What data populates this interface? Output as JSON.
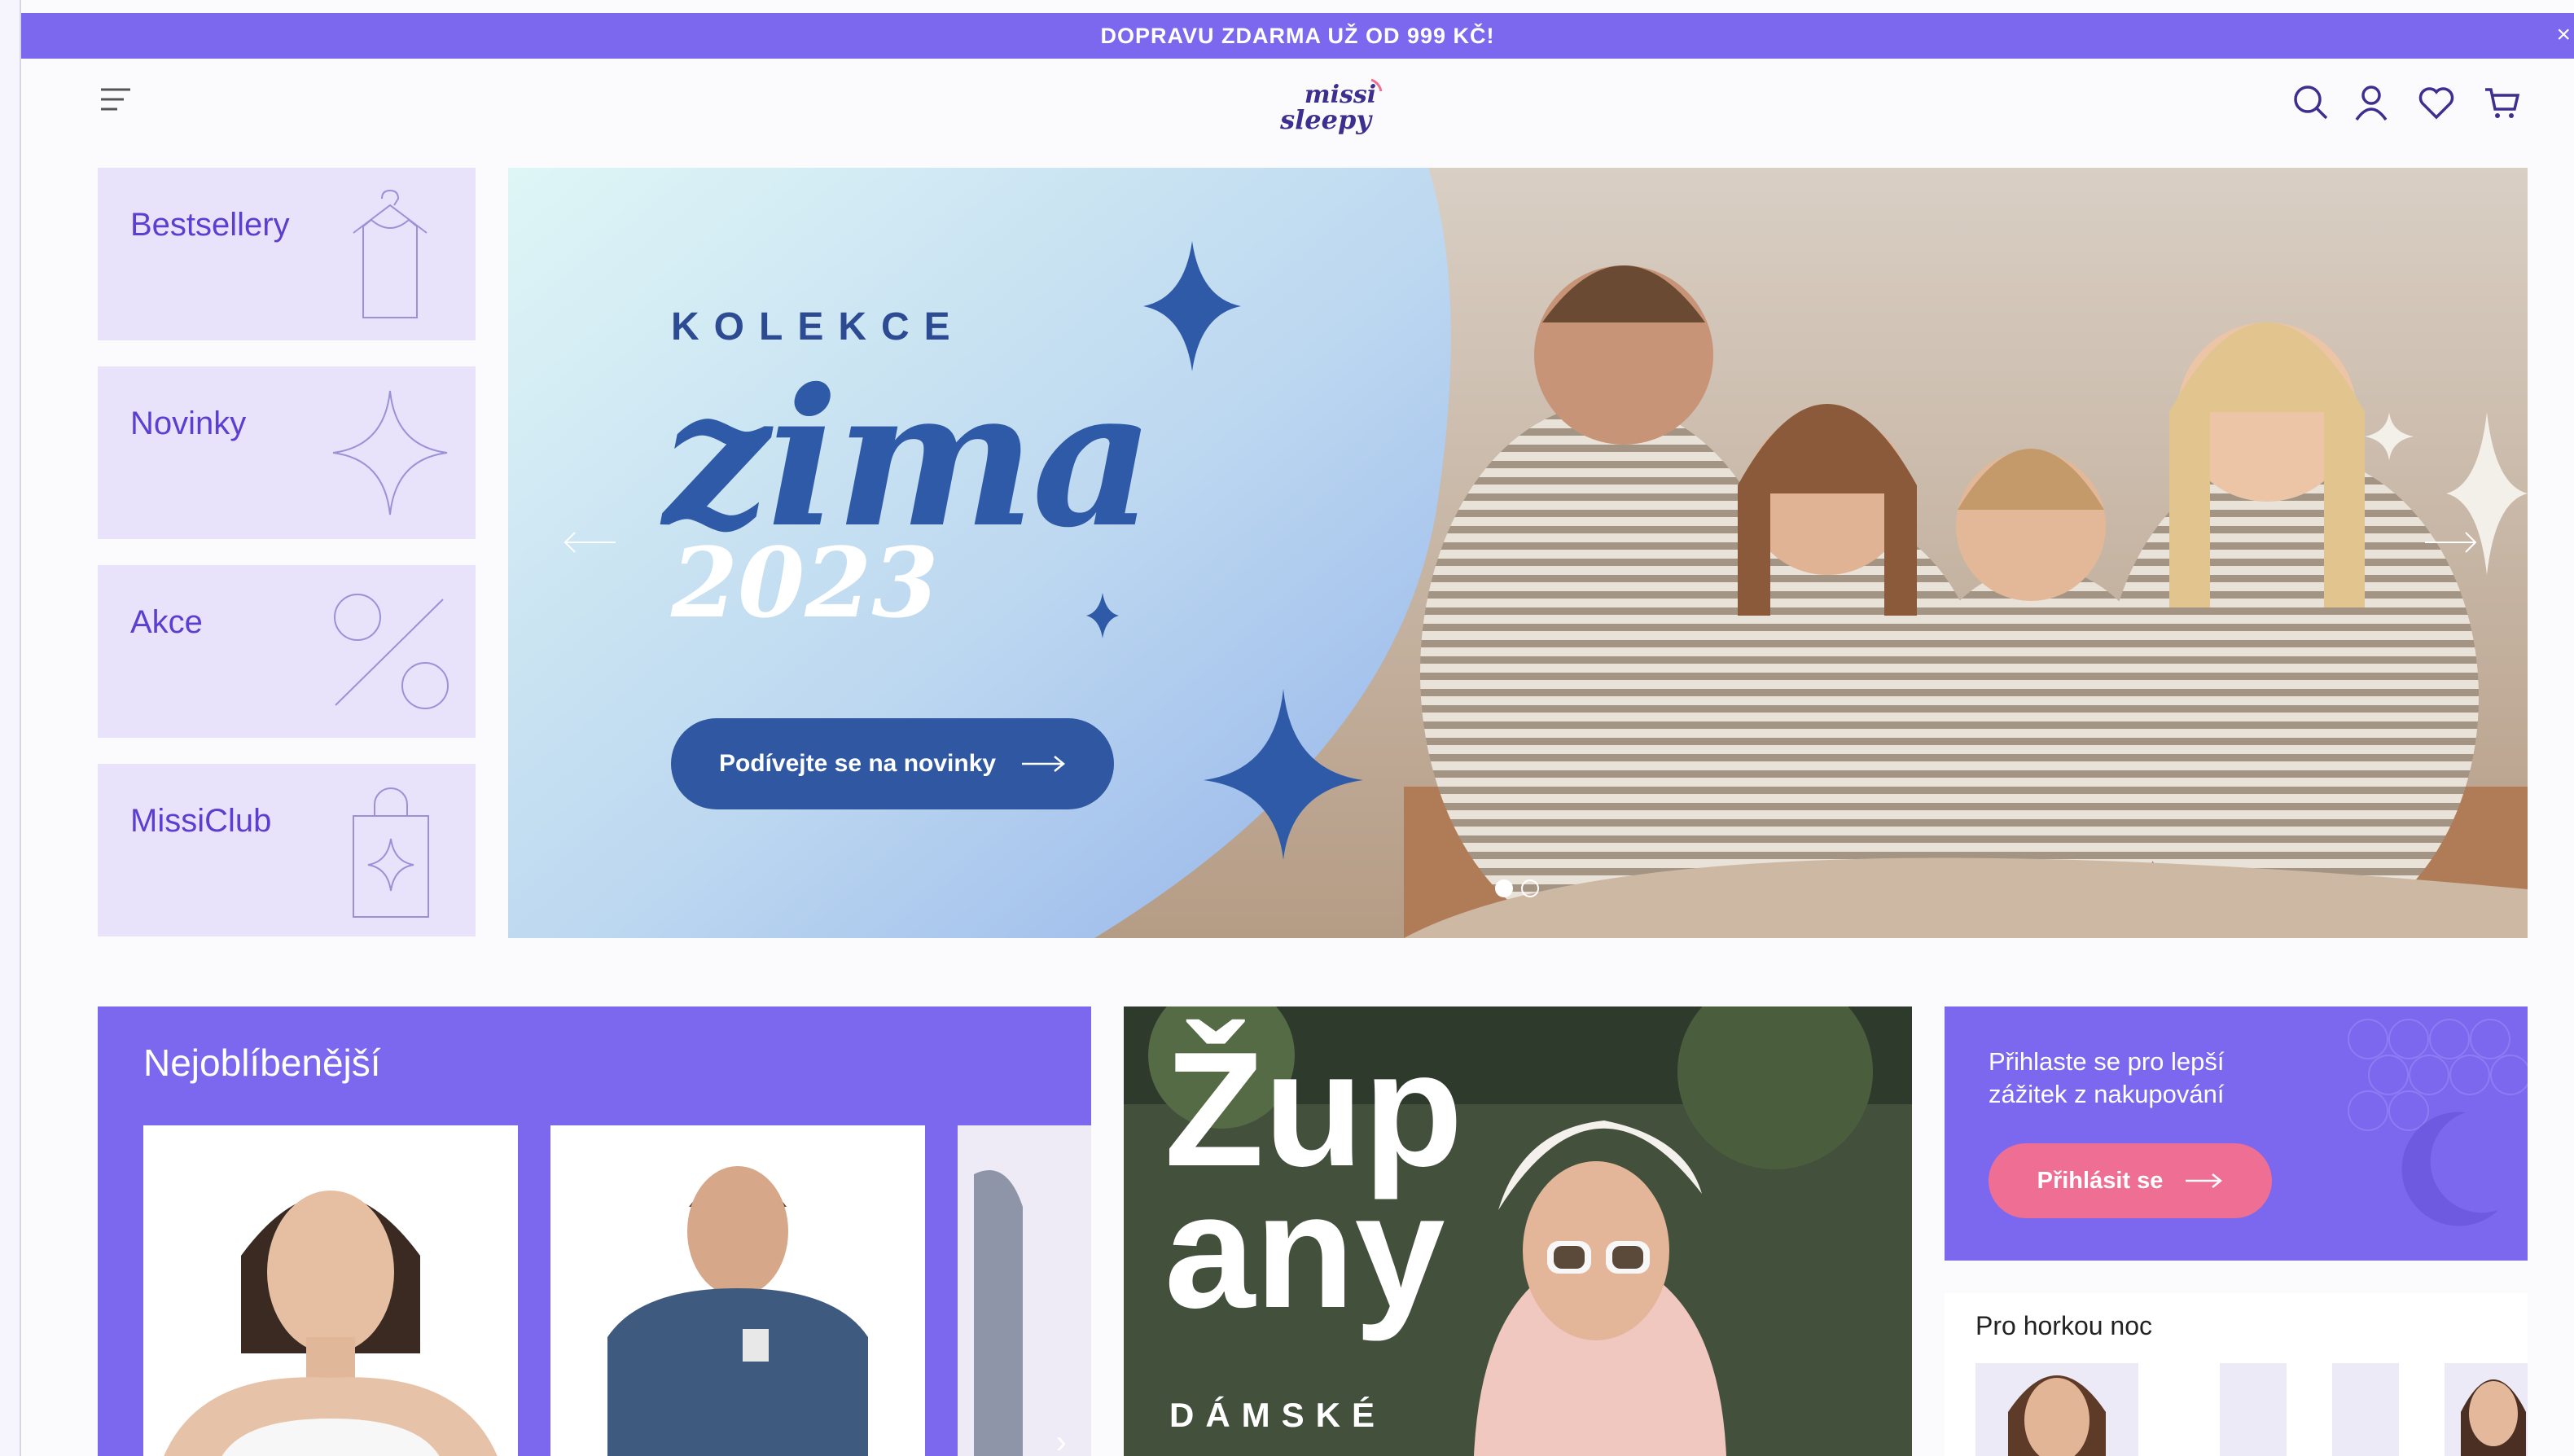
{
  "promo_bar": {
    "text": "DOPRAVU ZDARMA UŽ OD 999 KČ!",
    "close": "×"
  },
  "header": {
    "logo_line1": "missi",
    "logo_line2": "sleepy",
    "icons": [
      "menu-icon",
      "search-icon",
      "user-icon",
      "heart-icon",
      "cart-icon"
    ]
  },
  "categories": [
    {
      "label": "Bestsellery",
      "icon": "hanger-shirt-icon"
    },
    {
      "label": "Novinky",
      "icon": "sparkle-star-icon"
    },
    {
      "label": "Akce",
      "icon": "percent-icon"
    },
    {
      "label": "MissiClub",
      "icon": "shopping-bag-icon"
    }
  ],
  "hero": {
    "kicker": "KOLEKCE",
    "title": "zima",
    "year": "2023",
    "cta_label": "Podívejte se na novinky",
    "slide_count": 2,
    "active_slide": 1
  },
  "favorites": {
    "title": "Nejoblíbenější"
  },
  "robe_banner": {
    "title_line1": "Žup",
    "title_line2": "any",
    "subtitle": "DÁMSKÉ"
  },
  "login_promo": {
    "text": "Přihlaste se pro lepší zážitek z nakupování",
    "button_label": "Přihlásit se"
  },
  "hot_night": {
    "title": "Pro horkou noc"
  },
  "colors": {
    "accent": "#7b68ee",
    "hero_blue": "#2f57a2",
    "login_pink": "#ee6f93",
    "tile_bg": "#e8e3fb"
  }
}
